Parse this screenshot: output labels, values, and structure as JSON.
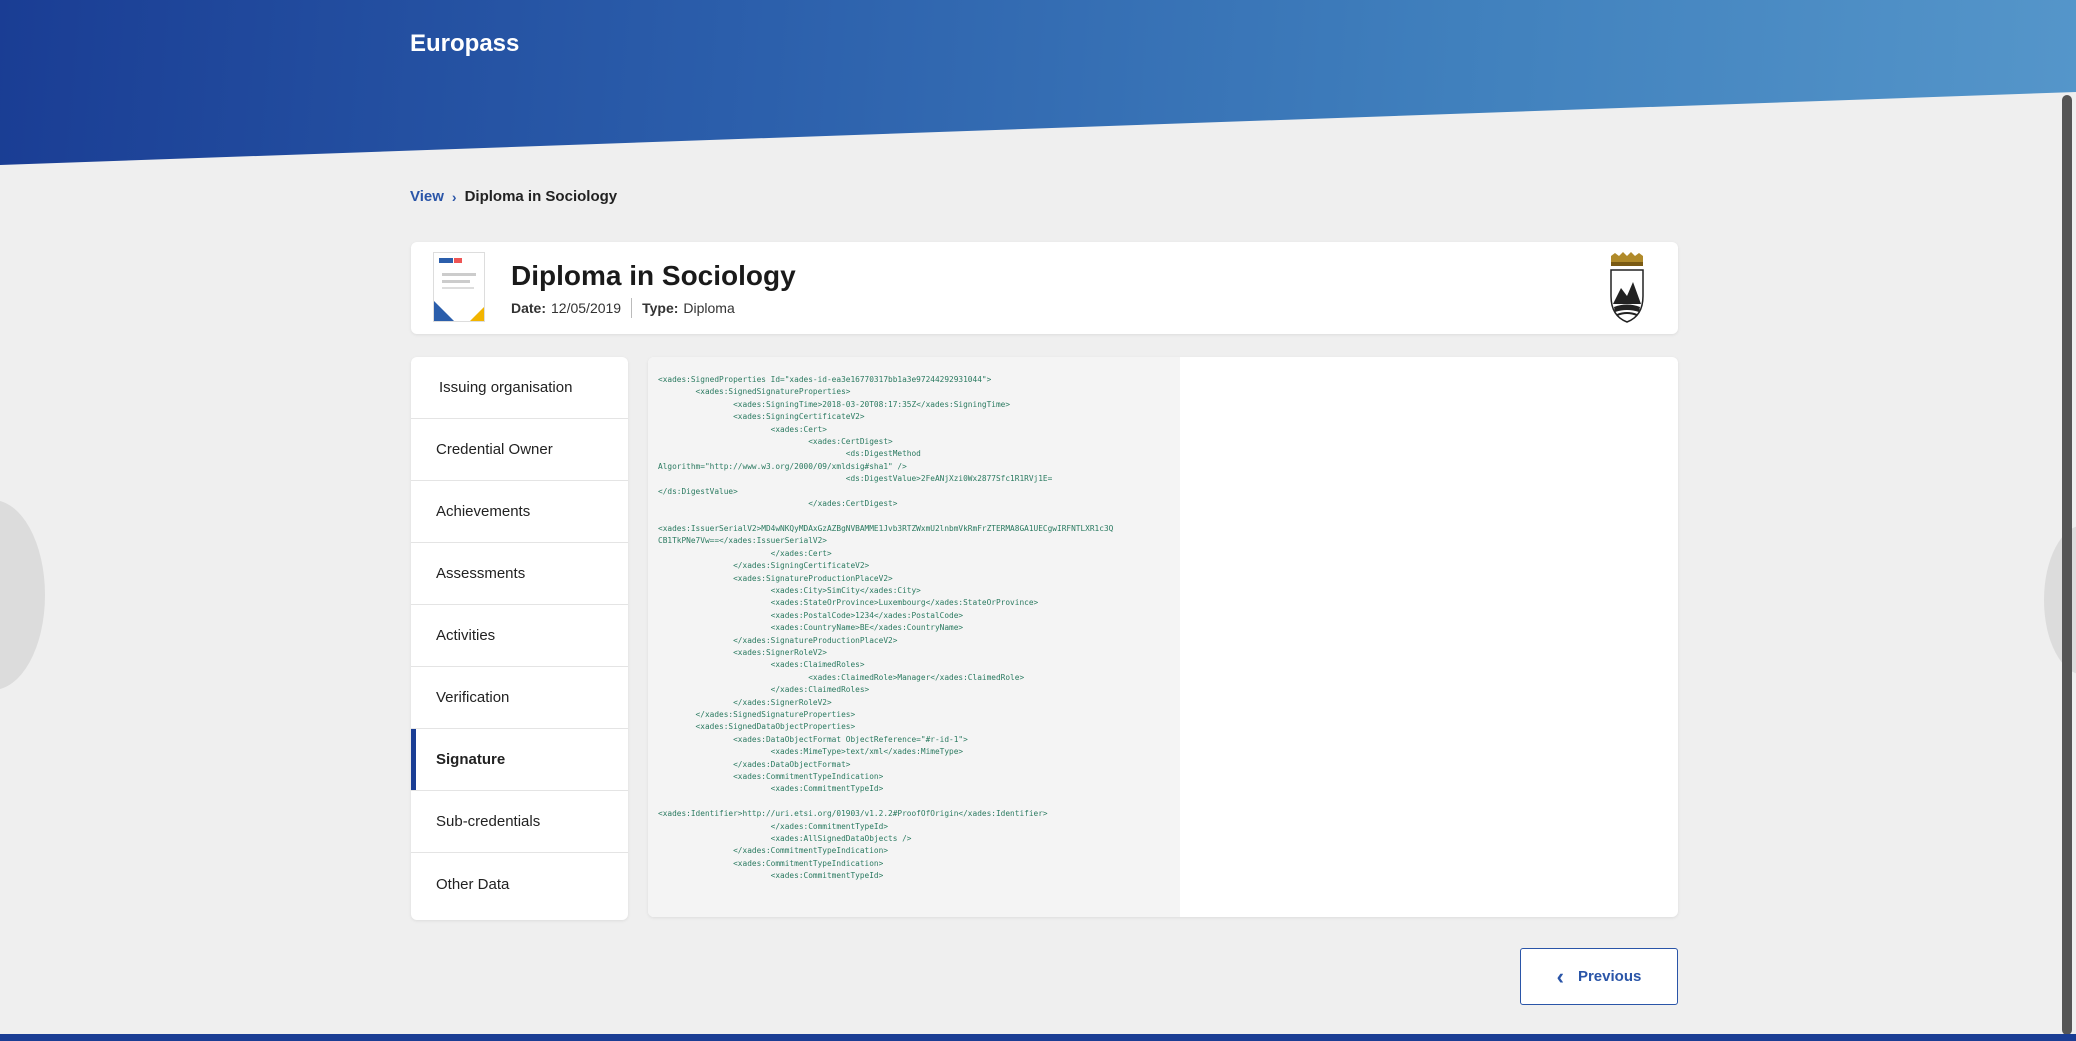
{
  "header": {
    "brand": "Europass"
  },
  "breadcrumb": {
    "link": "View",
    "separator": "›",
    "current": "Diploma in Sociology"
  },
  "credential": {
    "title": "Diploma in Sociology",
    "date_label": "Date:",
    "date_value": "12/05/2019",
    "type_label": "Type:",
    "type_value": "Diploma"
  },
  "nav": {
    "items": [
      {
        "label": "Issuing organisation"
      },
      {
        "label": "Credential Owner"
      },
      {
        "label": "Achievements"
      },
      {
        "label": "Assessments"
      },
      {
        "label": "Activities"
      },
      {
        "label": "Verification"
      },
      {
        "label": "Signature"
      },
      {
        "label": "Sub-credentials"
      },
      {
        "label": "Other Data"
      }
    ],
    "active": "Signature"
  },
  "xml": {
    "lines": [
      "<xades:SignedProperties Id=\"xades-id-ea3e16770317bb1a3e97244292931044\">",
      "        <xades:SignedSignatureProperties>",
      "                <xades:SigningTime>2018-03-20T08:17:35Z</xades:SigningTime>",
      "                <xades:SigningCertificateV2>",
      "                        <xades:Cert>",
      "                                <xades:CertDigest>",
      "                                        <ds:DigestMethod",
      "Algorithm=\"http://www.w3.org/2000/09/xmldsig#sha1\" />",
      "                                        <ds:DigestValue>2FeANjXzi0Wx2877Sfc1R1RVj1E=",
      "</ds:DigestValue>",
      "                                </xades:CertDigest>",
      "",
      "<xades:IssuerSerialV2>MD4wNKQyMDAxGzAZBgNVBAMME1Jvb3RTZWxmU2lnbmVkRmFrZTERMA8GA1UECgwIRFNTLXR1c3Q",
      "CB1TkPNe7Vw==</xades:IssuerSerialV2>",
      "                        </xades:Cert>",
      "                </xades:SigningCertificateV2>",
      "                <xades:SignatureProductionPlaceV2>",
      "                        <xades:City>SimCity</xades:City>",
      "                        <xades:StateOrProvince>Luxembourg</xades:StateOrProvince>",
      "                        <xades:PostalCode>1234</xades:PostalCode>",
      "                        <xades:CountryName>BE</xades:CountryName>",
      "                </xades:SignatureProductionPlaceV2>",
      "                <xades:SignerRoleV2>",
      "                        <xades:ClaimedRoles>",
      "                                <xades:ClaimedRole>Manager</xades:ClaimedRole>",
      "                        </xades:ClaimedRoles>",
      "                </xades:SignerRoleV2>",
      "        </xades:SignedSignatureProperties>",
      "        <xades:SignedDataObjectProperties>",
      "                <xades:DataObjectFormat ObjectReference=\"#r-id-1\">",
      "                        <xades:MimeType>text/xml</xades:MimeType>",
      "                </xades:DataObjectFormat>",
      "                <xades:CommitmentTypeIndication>",
      "                        <xades:CommitmentTypeId>",
      "",
      "<xades:Identifier>http://uri.etsi.org/01903/v1.2.2#ProofOfOrigin</xades:Identifier>",
      "                        </xades:CommitmentTypeId>",
      "                        <xades:AllSignedDataObjects />",
      "                </xades:CommitmentTypeIndication>",
      "                <xades:CommitmentTypeIndication>",
      "                        <xades:CommitmentTypeId>"
    ]
  },
  "footer": {
    "previous_label": "Previous"
  },
  "colors": {
    "brand_blue": "#1a3d94",
    "link_blue": "#2a55a8",
    "xml_text": "#2a7a60"
  }
}
